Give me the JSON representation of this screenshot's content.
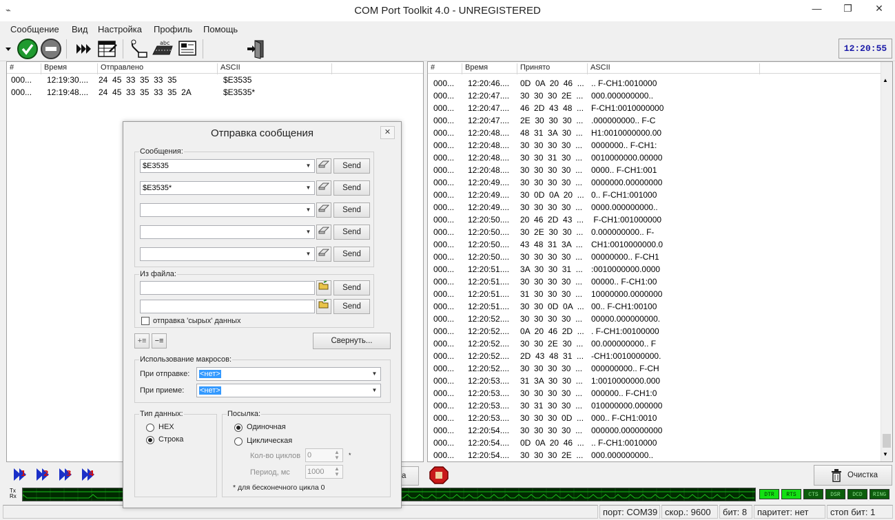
{
  "window": {
    "title": "COM Port Toolkit 4.0 - UNREGISTERED",
    "minimize_glyph": "—",
    "maximize_glyph": "❐",
    "close_glyph": "✕"
  },
  "menu": [
    "Сообщение",
    "Вид",
    "Настройка",
    "Профиль",
    "Помощь"
  ],
  "toolbar": {
    "clock": "12:20:55",
    "icons": [
      "dropdown-icon",
      "connect-check-icon",
      "disconnect-icon",
      "fast-forward-icon",
      "table-edit-icon",
      "port-settings-icon",
      "keyboard-icon",
      "terminal-icon",
      "exit-icon"
    ]
  },
  "sent_panel": {
    "columns": [
      "#",
      "Время",
      "Отправлено",
      "ASCII"
    ],
    "rows": [
      {
        "n": "000...",
        "time": "12:19:30....",
        "hex": "24  45  33  35  33  35",
        "ascii": "$E3535"
      },
      {
        "n": "000...",
        "time": "12:19:48....",
        "hex": "24  45  33  35  33  35  2A",
        "ascii": "$E3535*"
      }
    ]
  },
  "recv_panel": {
    "columns": [
      "#",
      "Время",
      "Принято",
      "ASCII"
    ],
    "rows": [
      {
        "n": "000...",
        "time": "12:20:46....",
        "hex": "0D  0A  20  46  ...",
        "ascii": ".. F-CH1:0010000"
      },
      {
        "n": "000...",
        "time": "12:20:47....",
        "hex": "30  30  30  2E  ...",
        "ascii": "000.000000000.."
      },
      {
        "n": "000...",
        "time": "12:20:47....",
        "hex": "46  2D  43  48  ...",
        "ascii": "F-CH1:0010000000"
      },
      {
        "n": "000...",
        "time": "12:20:47....",
        "hex": "2E  30  30  30  ...",
        "ascii": ".000000000.. F-C"
      },
      {
        "n": "000...",
        "time": "12:20:48....",
        "hex": "48  31  3A  30  ...",
        "ascii": "H1:0010000000.00"
      },
      {
        "n": "000...",
        "time": "12:20:48....",
        "hex": "30  30  30  30  ...",
        "ascii": "0000000.. F-CH1:"
      },
      {
        "n": "000...",
        "time": "12:20:48....",
        "hex": "30  30  31  30  ...",
        "ascii": "0010000000.00000"
      },
      {
        "n": "000...",
        "time": "12:20:48....",
        "hex": "30  30  30  30  ...",
        "ascii": "0000.. F-CH1:001"
      },
      {
        "n": "000...",
        "time": "12:20:49....",
        "hex": "30  30  30  30  ...",
        "ascii": "0000000.00000000"
      },
      {
        "n": "000...",
        "time": "12:20:49....",
        "hex": "30  0D  0A  20  ...",
        "ascii": "0.. F-CH1:001000"
      },
      {
        "n": "000...",
        "time": "12:20:49....",
        "hex": "30  30  30  30  ...",
        "ascii": "0000.000000000.."
      },
      {
        "n": "000...",
        "time": "12:20:50....",
        "hex": "20  46  2D  43  ...",
        "ascii": " F-CH1:001000000"
      },
      {
        "n": "000...",
        "time": "12:20:50....",
        "hex": "30  2E  30  30  ...",
        "ascii": "0.000000000.. F-"
      },
      {
        "n": "000...",
        "time": "12:20:50....",
        "hex": "43  48  31  3A  ...",
        "ascii": "CH1:0010000000.0"
      },
      {
        "n": "000...",
        "time": "12:20:50....",
        "hex": "30  30  30  30  ...",
        "ascii": "00000000.. F-CH1"
      },
      {
        "n": "000...",
        "time": "12:20:51....",
        "hex": "3A  30  30  31  ...",
        "ascii": ":0010000000.0000"
      },
      {
        "n": "000...",
        "time": "12:20:51....",
        "hex": "30  30  30  30  ...",
        "ascii": "00000.. F-CH1:00"
      },
      {
        "n": "000...",
        "time": "12:20:51....",
        "hex": "31  30  30  30  ...",
        "ascii": "10000000.0000000"
      },
      {
        "n": "000...",
        "time": "12:20:51....",
        "hex": "30  30  0D  0A  ...",
        "ascii": "00.. F-CH1:00100"
      },
      {
        "n": "000...",
        "time": "12:20:52....",
        "hex": "30  30  30  30  ...",
        "ascii": "00000.000000000."
      },
      {
        "n": "000...",
        "time": "12:20:52....",
        "hex": "0A  20  46  2D  ...",
        "ascii": ". F-CH1:00100000"
      },
      {
        "n": "000...",
        "time": "12:20:52....",
        "hex": "30  30  2E  30  ...",
        "ascii": "00.000000000.. F"
      },
      {
        "n": "000...",
        "time": "12:20:52....",
        "hex": "2D  43  48  31  ...",
        "ascii": "-CH1:0010000000."
      },
      {
        "n": "000...",
        "time": "12:20:52....",
        "hex": "30  30  30  30  ...",
        "ascii": "000000000.. F-CH"
      },
      {
        "n": "000...",
        "time": "12:20:53....",
        "hex": "31  3A  30  30  ...",
        "ascii": "1:0010000000.000"
      },
      {
        "n": "000...",
        "time": "12:20:53....",
        "hex": "30  30  30  30  ...",
        "ascii": "000000.. F-CH1:0"
      },
      {
        "n": "000...",
        "time": "12:20:53....",
        "hex": "30  31  30  30  ...",
        "ascii": "010000000.000000"
      },
      {
        "n": "000...",
        "time": "12:20:53....",
        "hex": "30  30  30  0D  ...",
        "ascii": "000.. F-CH1:0010"
      },
      {
        "n": "000...",
        "time": "12:20:54....",
        "hex": "30  30  30  30  ...",
        "ascii": "000000.000000000"
      },
      {
        "n": "000...",
        "time": "12:20:54....",
        "hex": "0D  0A  20  46  ...",
        "ascii": ".. F-CH1:0010000"
      },
      {
        "n": "000...",
        "time": "12:20:54....",
        "hex": "30  30  30  2E  ...",
        "ascii": "000.000000000.."
      }
    ]
  },
  "dialog": {
    "title": "Отправка сообщения",
    "messages_label": "Сообщения:",
    "messages": [
      "$E3535",
      "$E3535*",
      "",
      "",
      ""
    ],
    "send_label": "Send",
    "file_label": "Из файла:",
    "files": [
      "",
      ""
    ],
    "raw_checkbox_label": "отправка 'сырых' данных",
    "raw_checked": false,
    "collapse_button": "Свернуть...",
    "macros_label": "Использование макросов:",
    "on_send_label": "При отправке:",
    "on_send_value": "<нет>",
    "on_recv_label": "При приеме:",
    "on_recv_value": "<нет>",
    "datatype_label": "Тип данных:",
    "datatype_hex": "HEX",
    "datatype_string": "Строка",
    "datatype_selected": "Строка",
    "sending_label": "Посылка:",
    "single_label": "Одиночная",
    "cyclic_label": "Циклическая",
    "sending_selected": "Одиночная",
    "cycles_label": "Кол-во циклов",
    "cycles_value": "0",
    "cycles_star": "*",
    "period_label": "Период, мс",
    "period_value": "1000",
    "infinite_note": "* для бесконечного цикла  0"
  },
  "bottom": {
    "partial_button_text": "ка",
    "clear_button": "Очистка",
    "macro_icons": [
      "macro-1-icon",
      "macro-2-icon",
      "macro-3-icon",
      "macro-4-icon"
    ]
  },
  "signals": {
    "tx_label": "Tx",
    "rx_label": "Rx",
    "leds": [
      {
        "name": "DTR",
        "on": true
      },
      {
        "name": "RTS",
        "on": true
      },
      {
        "name": "CTS",
        "on": false
      },
      {
        "name": "DSR",
        "on": false
      },
      {
        "name": "DCD",
        "on": false
      },
      {
        "name": "RING",
        "on": false
      }
    ]
  },
  "status": {
    "port": "порт: COM39",
    "speed": "скор.: 9600",
    "bits": "бит: 8",
    "parity": "паритет: нет",
    "stop": "стоп бит: 1"
  },
  "colors": {
    "led_on": "#14e014",
    "led_off": "#0d5d0d",
    "clock": "#1a1aa8",
    "selection": "#3399ff",
    "scope_bg": "#002a00",
    "scope_line": "#19c019"
  }
}
